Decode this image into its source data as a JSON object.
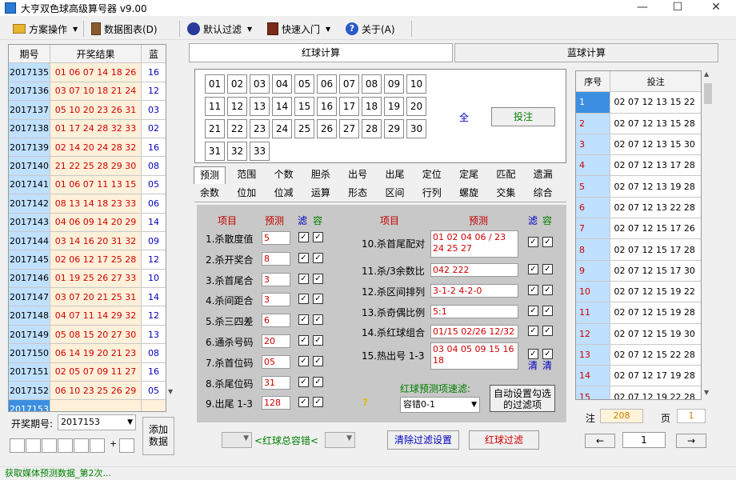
{
  "window": {
    "title": "大亨双色球高级算号器 v9.00"
  },
  "toolbar": {
    "scheme_ops": "方案操作",
    "data_chart": "数据图表(D)",
    "default_filter": "默认过滤",
    "quick_start": "快速入门",
    "about": "关于(A)"
  },
  "history": {
    "headers": {
      "issue": "期号",
      "result": "开奖结果",
      "blue": "蓝"
    },
    "rows": [
      {
        "issue": "2017135",
        "reds": "01 06 07 14 18 26",
        "blue": "16"
      },
      {
        "issue": "2017136",
        "reds": "03 07 10 18 21 24",
        "blue": "12"
      },
      {
        "issue": "2017137",
        "reds": "05 10 20 23 26 31",
        "blue": "03"
      },
      {
        "issue": "2017138",
        "reds": "01 17 24 28 32 33",
        "blue": "02"
      },
      {
        "issue": "2017139",
        "reds": "02 14 20 24 28 32",
        "blue": "16"
      },
      {
        "issue": "2017140",
        "reds": "21 22 25 28 29 30",
        "blue": "08"
      },
      {
        "issue": "2017141",
        "reds": "01 06 07 11 13 15",
        "blue": "05"
      },
      {
        "issue": "2017142",
        "reds": "08 13 14 18 23 33",
        "blue": "06"
      },
      {
        "issue": "2017143",
        "reds": "04 06 09 14 20 29",
        "blue": "14"
      },
      {
        "issue": "2017144",
        "reds": "03 14 16 20 31 32",
        "blue": "09"
      },
      {
        "issue": "2017145",
        "reds": "02 06 12 17 25 28",
        "blue": "12"
      },
      {
        "issue": "2017146",
        "reds": "01 19 25 26 27 33",
        "blue": "10"
      },
      {
        "issue": "2017147",
        "reds": "03 07 20 21 25 31",
        "blue": "14"
      },
      {
        "issue": "2017148",
        "reds": "04 07 11 14 29 32",
        "blue": "12"
      },
      {
        "issue": "2017149",
        "reds": "05 08 15 20 27 30",
        "blue": "13"
      },
      {
        "issue": "2017150",
        "reds": "06 14 19 20 21 23",
        "blue": "08"
      },
      {
        "issue": "2017151",
        "reds": "02 05 07 09 11 27",
        "blue": "16"
      },
      {
        "issue": "2017152",
        "reds": "06 10 23 25 26 29",
        "blue": "05"
      },
      {
        "issue": "2017153",
        "reds": "",
        "blue": ""
      }
    ]
  },
  "issue_input": {
    "label": "开奖期号:",
    "value": "2017153",
    "plus": "+"
  },
  "add_button": "添加数据",
  "tabs": {
    "red": "红球计算",
    "blue": "蓝球计算"
  },
  "numbers": [
    "01",
    "02",
    "03",
    "04",
    "05",
    "06",
    "07",
    "08",
    "09",
    "10",
    "11",
    "12",
    "13",
    "14",
    "15",
    "16",
    "17",
    "18",
    "19",
    "20",
    "21",
    "22",
    "23",
    "24",
    "25",
    "26",
    "27",
    "28",
    "29",
    "30",
    "31",
    "32",
    "33"
  ],
  "all_label": "全",
  "bet_label": "投注",
  "filter_tabs": {
    "row1": [
      "预测",
      "范围",
      "个数",
      "胆杀",
      "出号",
      "出尾",
      "定位",
      "定尾",
      "匹配",
      "遗漏"
    ],
    "row2": [
      "余数",
      "位加",
      "位减",
      "运算",
      "形态",
      "区间",
      "行列",
      "螺旋",
      "交集",
      "综合"
    ]
  },
  "panel": {
    "h_item": "项目",
    "h_pred": "预测",
    "h_filter": "滤",
    "h_tol": "容",
    "left": [
      {
        "label": "1.杀散度值",
        "value": "5"
      },
      {
        "label": "2.杀开奖合",
        "value": "8"
      },
      {
        "label": "3.杀首尾合",
        "value": "3"
      },
      {
        "label": "4.杀间距合",
        "value": "3"
      },
      {
        "label": "5.杀三四差",
        "value": "6"
      },
      {
        "label": "6.通杀号码",
        "value": "20"
      },
      {
        "label": "7.杀首位码",
        "value": "05"
      },
      {
        "label": "8.杀尾位码",
        "value": "31"
      },
      {
        "label": "9.出尾 1-3",
        "value": "128"
      }
    ],
    "right": [
      {
        "label": "10.杀首尾配对",
        "value": "01 02 04 06 / 23 24 25 27",
        "tall": true
      },
      {
        "label": "11.杀/3余数比",
        "value": "042 222"
      },
      {
        "label": "12.杀区间排列",
        "value": "3-1-2 4-2-0"
      },
      {
        "label": "13.杀奇偶比例",
        "value": "5:1"
      },
      {
        "label": "14.杀红球组合",
        "value": "01/15 02/26 12/32"
      },
      {
        "label": "15.热出号 1-3",
        "value": "03 04 05 09 15 16 18",
        "tall": true
      }
    ],
    "clear1": "清",
    "clear2": "清",
    "question": "?",
    "filter_label": "红球预测项速滤:",
    "filter_value": "容错0-1",
    "auto_button": "自动设置勾选的过滤项"
  },
  "bottom": {
    "tolerance_label": "<红球总容错<",
    "clear_button": "清除过滤设置",
    "red_filter_button": "红球过滤"
  },
  "bets": {
    "headers": {
      "no": "序号",
      "bet": "投注"
    },
    "rows": [
      {
        "no": "1",
        "nums": "02 07 12 13 15 22"
      },
      {
        "no": "2",
        "nums": "02 07 12 13 15 28"
      },
      {
        "no": "3",
        "nums": "02 07 12 13 15 30"
      },
      {
        "no": "4",
        "nums": "02 07 12 13 17 28"
      },
      {
        "no": "5",
        "nums": "02 07 12 13 19 28"
      },
      {
        "no": "6",
        "nums": "02 07 12 13 22 28"
      },
      {
        "no": "7",
        "nums": "02 07 12 15 17 26"
      },
      {
        "no": "8",
        "nums": "02 07 12 15 17 28"
      },
      {
        "no": "9",
        "nums": "02 07 12 15 17 30"
      },
      {
        "no": "10",
        "nums": "02 07 12 15 19 22"
      },
      {
        "no": "11",
        "nums": "02 07 12 15 19 28"
      },
      {
        "no": "12",
        "nums": "02 07 12 15 19 30"
      },
      {
        "no": "13",
        "nums": "02 07 12 15 22 28"
      },
      {
        "no": "14",
        "nums": "02 07 12 17 19 28"
      },
      {
        "no": "15",
        "nums": "02 07 12 19 22 28"
      }
    ]
  },
  "summary": {
    "zhu_label": "注",
    "zhu": "208",
    "ye_label": "页",
    "ye": "1",
    "page": "1",
    "prev": "←",
    "next": "→"
  },
  "status": "获取媒体预测数据_第2次..."
}
